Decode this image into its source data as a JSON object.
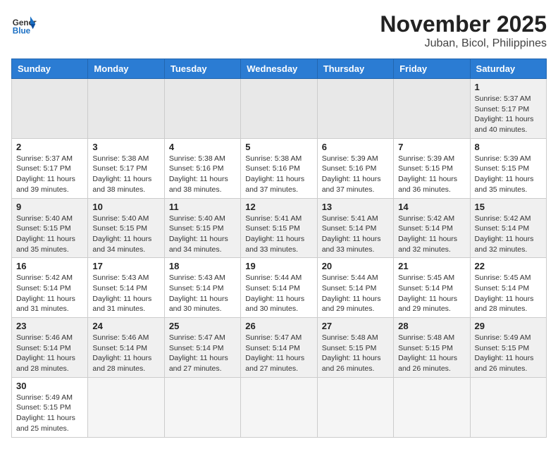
{
  "header": {
    "logo_general": "General",
    "logo_blue": "Blue",
    "month_title": "November 2025",
    "location": "Juban, Bicol, Philippines"
  },
  "weekdays": [
    "Sunday",
    "Monday",
    "Tuesday",
    "Wednesday",
    "Thursday",
    "Friday",
    "Saturday"
  ],
  "weeks": [
    [
      {
        "day": "",
        "info": ""
      },
      {
        "day": "",
        "info": ""
      },
      {
        "day": "",
        "info": ""
      },
      {
        "day": "",
        "info": ""
      },
      {
        "day": "",
        "info": ""
      },
      {
        "day": "",
        "info": ""
      },
      {
        "day": "1",
        "info": "Sunrise: 5:37 AM\nSunset: 5:17 PM\nDaylight: 11 hours\nand 40 minutes."
      }
    ],
    [
      {
        "day": "2",
        "info": "Sunrise: 5:37 AM\nSunset: 5:17 PM\nDaylight: 11 hours\nand 39 minutes."
      },
      {
        "day": "3",
        "info": "Sunrise: 5:38 AM\nSunset: 5:17 PM\nDaylight: 11 hours\nand 38 minutes."
      },
      {
        "day": "4",
        "info": "Sunrise: 5:38 AM\nSunset: 5:16 PM\nDaylight: 11 hours\nand 38 minutes."
      },
      {
        "day": "5",
        "info": "Sunrise: 5:38 AM\nSunset: 5:16 PM\nDaylight: 11 hours\nand 37 minutes."
      },
      {
        "day": "6",
        "info": "Sunrise: 5:39 AM\nSunset: 5:16 PM\nDaylight: 11 hours\nand 37 minutes."
      },
      {
        "day": "7",
        "info": "Sunrise: 5:39 AM\nSunset: 5:15 PM\nDaylight: 11 hours\nand 36 minutes."
      },
      {
        "day": "8",
        "info": "Sunrise: 5:39 AM\nSunset: 5:15 PM\nDaylight: 11 hours\nand 35 minutes."
      }
    ],
    [
      {
        "day": "9",
        "info": "Sunrise: 5:40 AM\nSunset: 5:15 PM\nDaylight: 11 hours\nand 35 minutes."
      },
      {
        "day": "10",
        "info": "Sunrise: 5:40 AM\nSunset: 5:15 PM\nDaylight: 11 hours\nand 34 minutes."
      },
      {
        "day": "11",
        "info": "Sunrise: 5:40 AM\nSunset: 5:15 PM\nDaylight: 11 hours\nand 34 minutes."
      },
      {
        "day": "12",
        "info": "Sunrise: 5:41 AM\nSunset: 5:15 PM\nDaylight: 11 hours\nand 33 minutes."
      },
      {
        "day": "13",
        "info": "Sunrise: 5:41 AM\nSunset: 5:14 PM\nDaylight: 11 hours\nand 33 minutes."
      },
      {
        "day": "14",
        "info": "Sunrise: 5:42 AM\nSunset: 5:14 PM\nDaylight: 11 hours\nand 32 minutes."
      },
      {
        "day": "15",
        "info": "Sunrise: 5:42 AM\nSunset: 5:14 PM\nDaylight: 11 hours\nand 32 minutes."
      }
    ],
    [
      {
        "day": "16",
        "info": "Sunrise: 5:42 AM\nSunset: 5:14 PM\nDaylight: 11 hours\nand 31 minutes."
      },
      {
        "day": "17",
        "info": "Sunrise: 5:43 AM\nSunset: 5:14 PM\nDaylight: 11 hours\nand 31 minutes."
      },
      {
        "day": "18",
        "info": "Sunrise: 5:43 AM\nSunset: 5:14 PM\nDaylight: 11 hours\nand 30 minutes."
      },
      {
        "day": "19",
        "info": "Sunrise: 5:44 AM\nSunset: 5:14 PM\nDaylight: 11 hours\nand 30 minutes."
      },
      {
        "day": "20",
        "info": "Sunrise: 5:44 AM\nSunset: 5:14 PM\nDaylight: 11 hours\nand 29 minutes."
      },
      {
        "day": "21",
        "info": "Sunrise: 5:45 AM\nSunset: 5:14 PM\nDaylight: 11 hours\nand 29 minutes."
      },
      {
        "day": "22",
        "info": "Sunrise: 5:45 AM\nSunset: 5:14 PM\nDaylight: 11 hours\nand 28 minutes."
      }
    ],
    [
      {
        "day": "23",
        "info": "Sunrise: 5:46 AM\nSunset: 5:14 PM\nDaylight: 11 hours\nand 28 minutes."
      },
      {
        "day": "24",
        "info": "Sunrise: 5:46 AM\nSunset: 5:14 PM\nDaylight: 11 hours\nand 28 minutes."
      },
      {
        "day": "25",
        "info": "Sunrise: 5:47 AM\nSunset: 5:14 PM\nDaylight: 11 hours\nand 27 minutes."
      },
      {
        "day": "26",
        "info": "Sunrise: 5:47 AM\nSunset: 5:14 PM\nDaylight: 11 hours\nand 27 minutes."
      },
      {
        "day": "27",
        "info": "Sunrise: 5:48 AM\nSunset: 5:15 PM\nDaylight: 11 hours\nand 26 minutes."
      },
      {
        "day": "28",
        "info": "Sunrise: 5:48 AM\nSunset: 5:15 PM\nDaylight: 11 hours\nand 26 minutes."
      },
      {
        "day": "29",
        "info": "Sunrise: 5:49 AM\nSunset: 5:15 PM\nDaylight: 11 hours\nand 26 minutes."
      }
    ],
    [
      {
        "day": "30",
        "info": "Sunrise: 5:49 AM\nSunset: 5:15 PM\nDaylight: 11 hours\nand 25 minutes."
      },
      {
        "day": "",
        "info": ""
      },
      {
        "day": "",
        "info": ""
      },
      {
        "day": "",
        "info": ""
      },
      {
        "day": "",
        "info": ""
      },
      {
        "day": "",
        "info": ""
      },
      {
        "day": "",
        "info": ""
      }
    ]
  ]
}
